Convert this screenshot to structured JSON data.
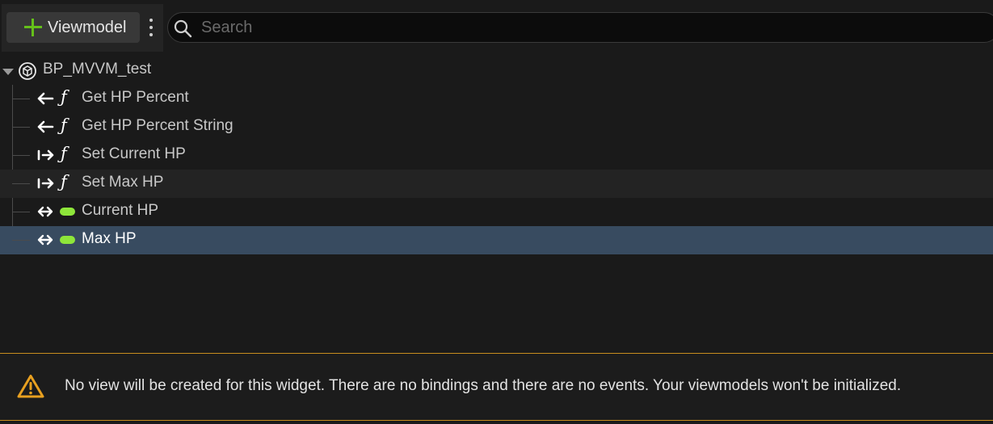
{
  "toolbar": {
    "add_viewmodel_label": "Viewmodel",
    "search_placeholder": "Search",
    "search_value": ""
  },
  "tree": {
    "root": {
      "label": "BP_MVVM_test",
      "icon": "cube-icon",
      "expanded": true
    },
    "items": [
      {
        "label": "Get HP Percent",
        "direction": "arrow-left-icon",
        "kind": "function-icon"
      },
      {
        "label": "Get HP Percent String",
        "direction": "arrow-left-icon",
        "kind": "function-icon"
      },
      {
        "label": "Set Current HP",
        "direction": "arrow-right-icon",
        "kind": "function-icon"
      },
      {
        "label": "Set Max HP",
        "direction": "arrow-right-icon",
        "kind": "function-icon",
        "hovered": true
      },
      {
        "label": "Current HP",
        "direction": "arrow-both-icon",
        "kind": "property-pill-icon"
      },
      {
        "label": "Max HP",
        "direction": "arrow-both-icon",
        "kind": "property-pill-icon",
        "selected": true
      }
    ]
  },
  "warning": {
    "icon": "warning-triangle-icon",
    "text": "No view will be created for this widget. There are no bindings and there are no events. Your viewmodels won't be initialized."
  },
  "colors": {
    "background": "#1a1a1a",
    "selected_row": "#384b60",
    "add_icon": "#65c01a",
    "property_pill": "#8ee63a",
    "warning_accent": "#e8a020"
  }
}
